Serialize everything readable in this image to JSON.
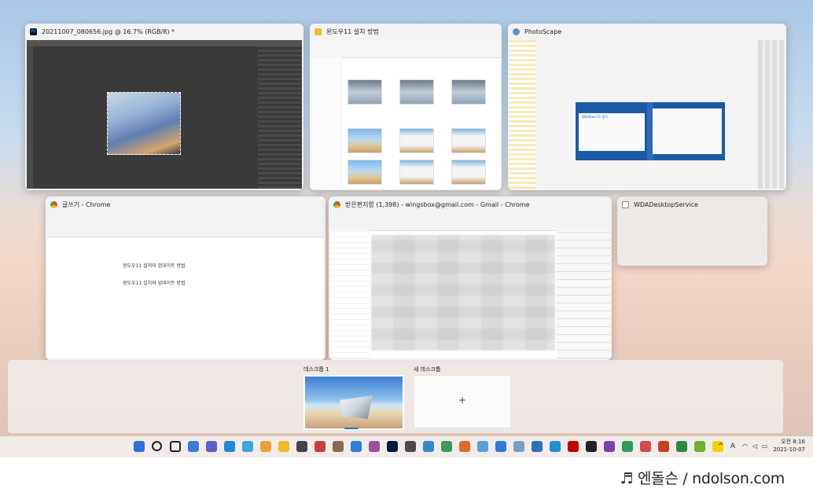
{
  "windows": [
    {
      "title": "20211007_080656.jpg @ 16.7% (RGB/8) *",
      "app": "photoshop",
      "icon": "photoshop-icon",
      "icon_text": "Ps",
      "color": "#001e36"
    },
    {
      "title": "윈도우11 설치 방법",
      "app": "file-explorer",
      "icon": "folder-icon",
      "color": "#f2b82e"
    },
    {
      "title": "PhotoScape",
      "app": "photoscape",
      "icon": "photoscape-icon",
      "color": "#5b8fd6"
    },
    {
      "title": "글쓰기 - Chrome",
      "app": "chrome",
      "icon": "chrome-icon",
      "color": "#4285f4"
    },
    {
      "title": "받은편지함 (1,398) - wingsbox@gmail.com - Gmail - Chrome",
      "app": "chrome",
      "icon": "chrome-icon",
      "color": "#4285f4"
    },
    {
      "title": "WDADesktopService",
      "app": "service",
      "icon": "window-icon",
      "color": "#888888"
    }
  ],
  "docs": {
    "heading": "윈도우11 설치와 업데이트 방법",
    "body": "윈도우11 설치와 업데이트 방법"
  },
  "photoscape_dialog": {
    "title": "Windows 11 설치"
  },
  "desktops": {
    "current_label": "데스크톱 1",
    "new_label": "새 데스크톱",
    "new_icon": "+"
  },
  "taskbar": {
    "icons": [
      "windows-start-icon",
      "search-icon",
      "task-view-icon",
      "widgets-icon",
      "teams-chat-icon",
      "edge-icon",
      "photos-icon",
      "chrome-icon",
      "file-explorer-icon",
      "store-icon",
      "app-icon",
      "app-icon",
      "app-icon",
      "app-icon",
      "photoshop-icon",
      "app-icon",
      "app-icon",
      "app-icon",
      "app-icon",
      "app-icon",
      "app-icon",
      "app-icon",
      "app-icon",
      "app-icon",
      "filezilla-icon",
      "app-icon",
      "app-icon",
      "app-icon",
      "app-icon",
      "powerpoint-icon",
      "app-icon",
      "app-icon",
      "kakaotalk-icon"
    ],
    "tray": {
      "chevron": "^",
      "ime": "A",
      "wifi": "wifi-icon",
      "volume": "volume-icon",
      "battery": "battery-icon"
    },
    "time": "오전 8:16",
    "date": "2021-10-07"
  },
  "watermark": "♬ 엔돌슨 / ndolson.com"
}
